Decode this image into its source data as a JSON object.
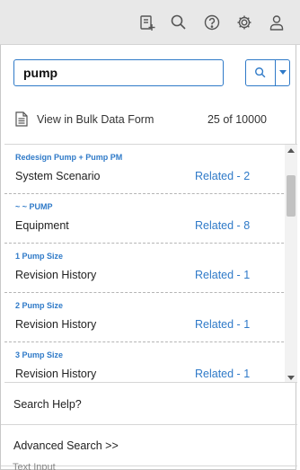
{
  "toolbar": {
    "icons": [
      "add-record-icon",
      "search-icon",
      "help-icon",
      "gear-icon",
      "user-icon"
    ]
  },
  "search": {
    "value": "pump"
  },
  "bulk": {
    "label": "View in Bulk Data Form",
    "count": "25 of 10000"
  },
  "results": [
    {
      "title": "Redesign Pump + Pump PM",
      "family": "System Scenario",
      "related": "Related - 2"
    },
    {
      "title": "~ ~ PUMP",
      "family": "Equipment",
      "related": "Related - 8"
    },
    {
      "title": "1 Pump Size",
      "family": "Revision History",
      "related": "Related - 1"
    },
    {
      "title": "2 Pump Size",
      "family": "Revision History",
      "related": "Related - 1"
    },
    {
      "title": "3 Pump Size",
      "family": "Revision History",
      "related": "Related - 1"
    }
  ],
  "footer": {
    "help": "Search Help?",
    "advanced": "Advanced Search >>"
  },
  "background_text": "Text Input",
  "colors": {
    "accent": "#2f7ac8",
    "topbar": "#e8e8e8"
  }
}
